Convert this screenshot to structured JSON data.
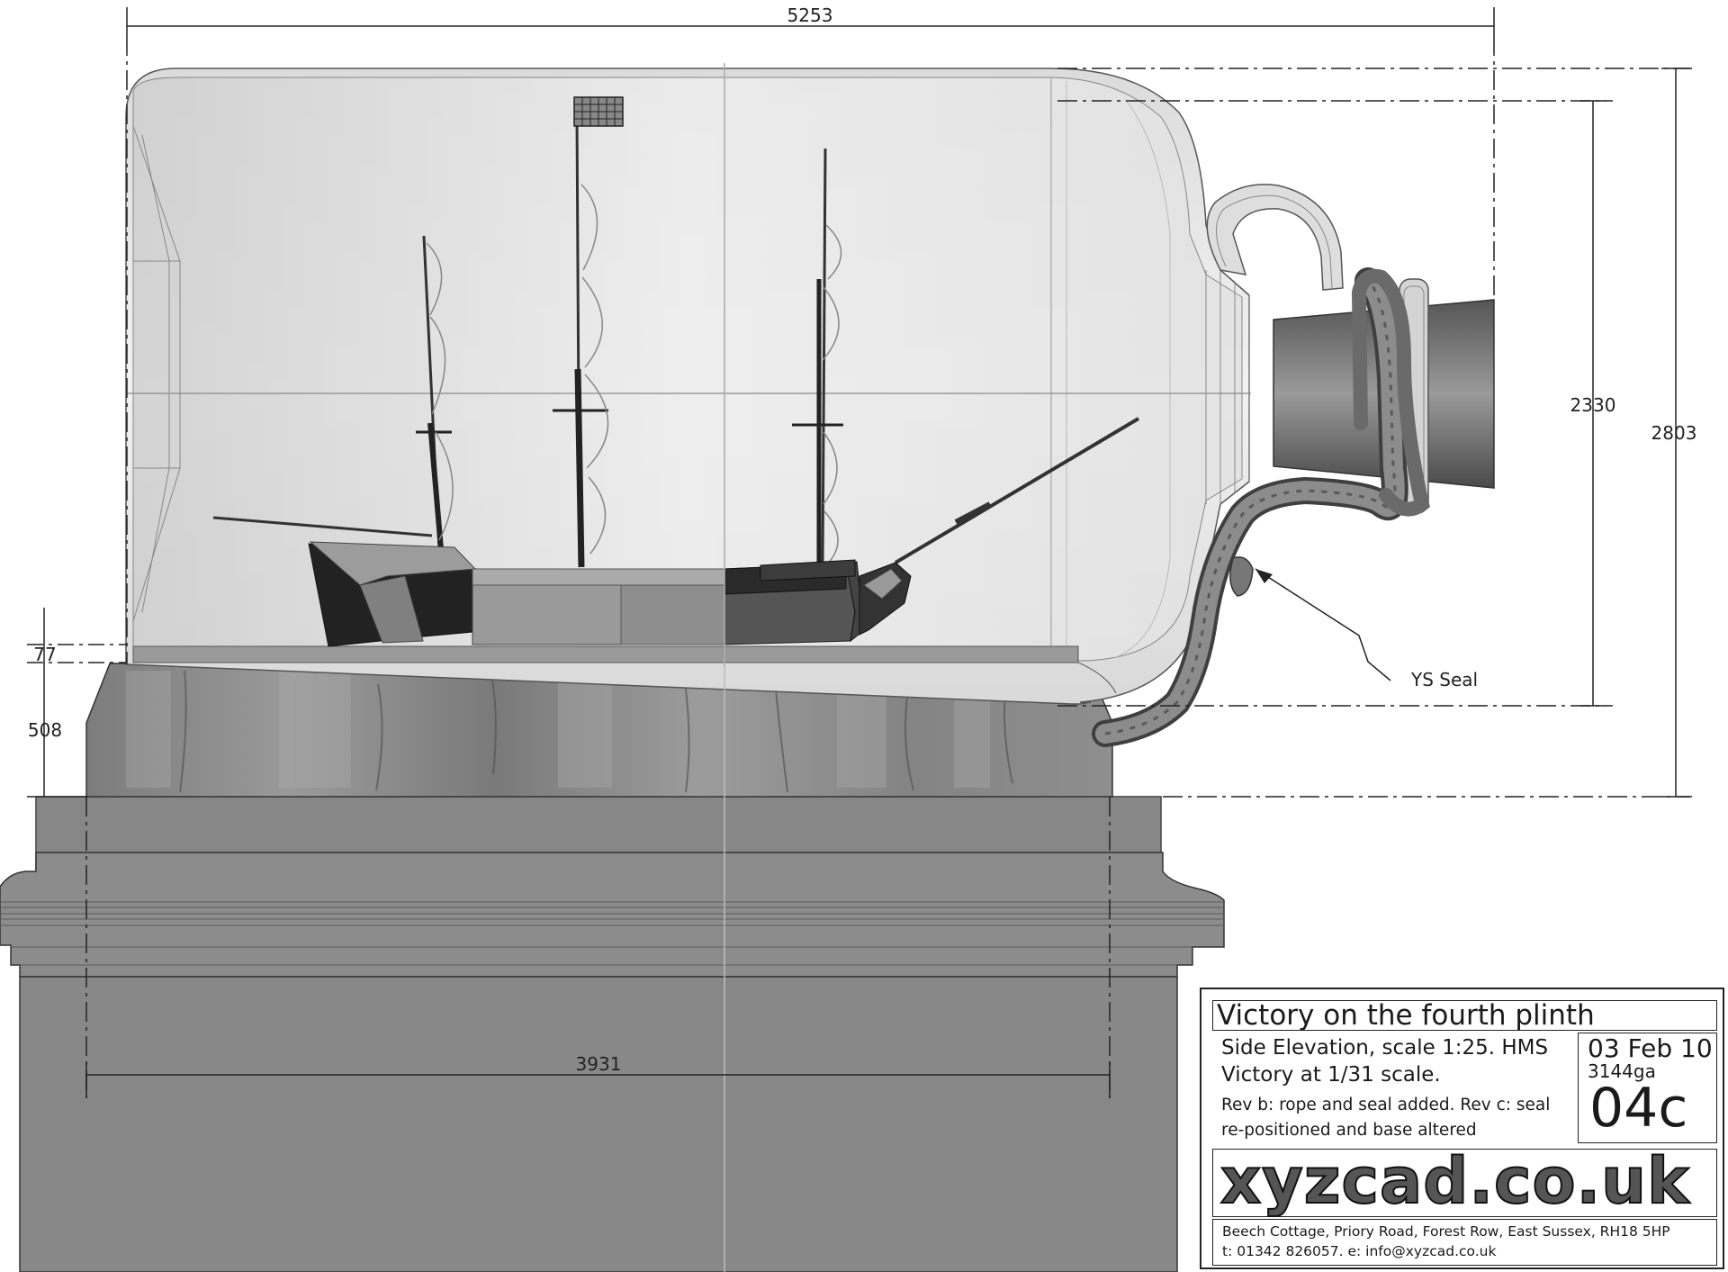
{
  "dimensions": {
    "overall_length": "5253",
    "bottle_height": "2330",
    "overall_height": "2803",
    "floor_thickness": "77",
    "plinth_top_height": "508",
    "plinth_width": "3931"
  },
  "callouts": {
    "seal": "YS Seal"
  },
  "title_block": {
    "title": "Victory on the fourth plinth",
    "description_line1": "Side Elevation, scale 1:25. HMS",
    "description_line2": "Victory at 1/31 scale.",
    "revision_line1": "Rev b: rope and seal added. Rev c: seal",
    "revision_line2": "re-positioned and base altered",
    "date": "03 Feb 10",
    "job_number": "3144ga",
    "drawing_number": "04c",
    "logo": "xyzcad.co.uk",
    "address": "Beech Cottage, Priory Road, Forest Row, East Sussex, RH18 5HP",
    "contact": "t: 01342 826057. e: info@xyzcad.co.uk"
  },
  "colors": {
    "line": "#222222",
    "plinth": "#858585",
    "stone": "#8a8a8a",
    "glass": "#e4e4e4",
    "hull": "#555555"
  }
}
